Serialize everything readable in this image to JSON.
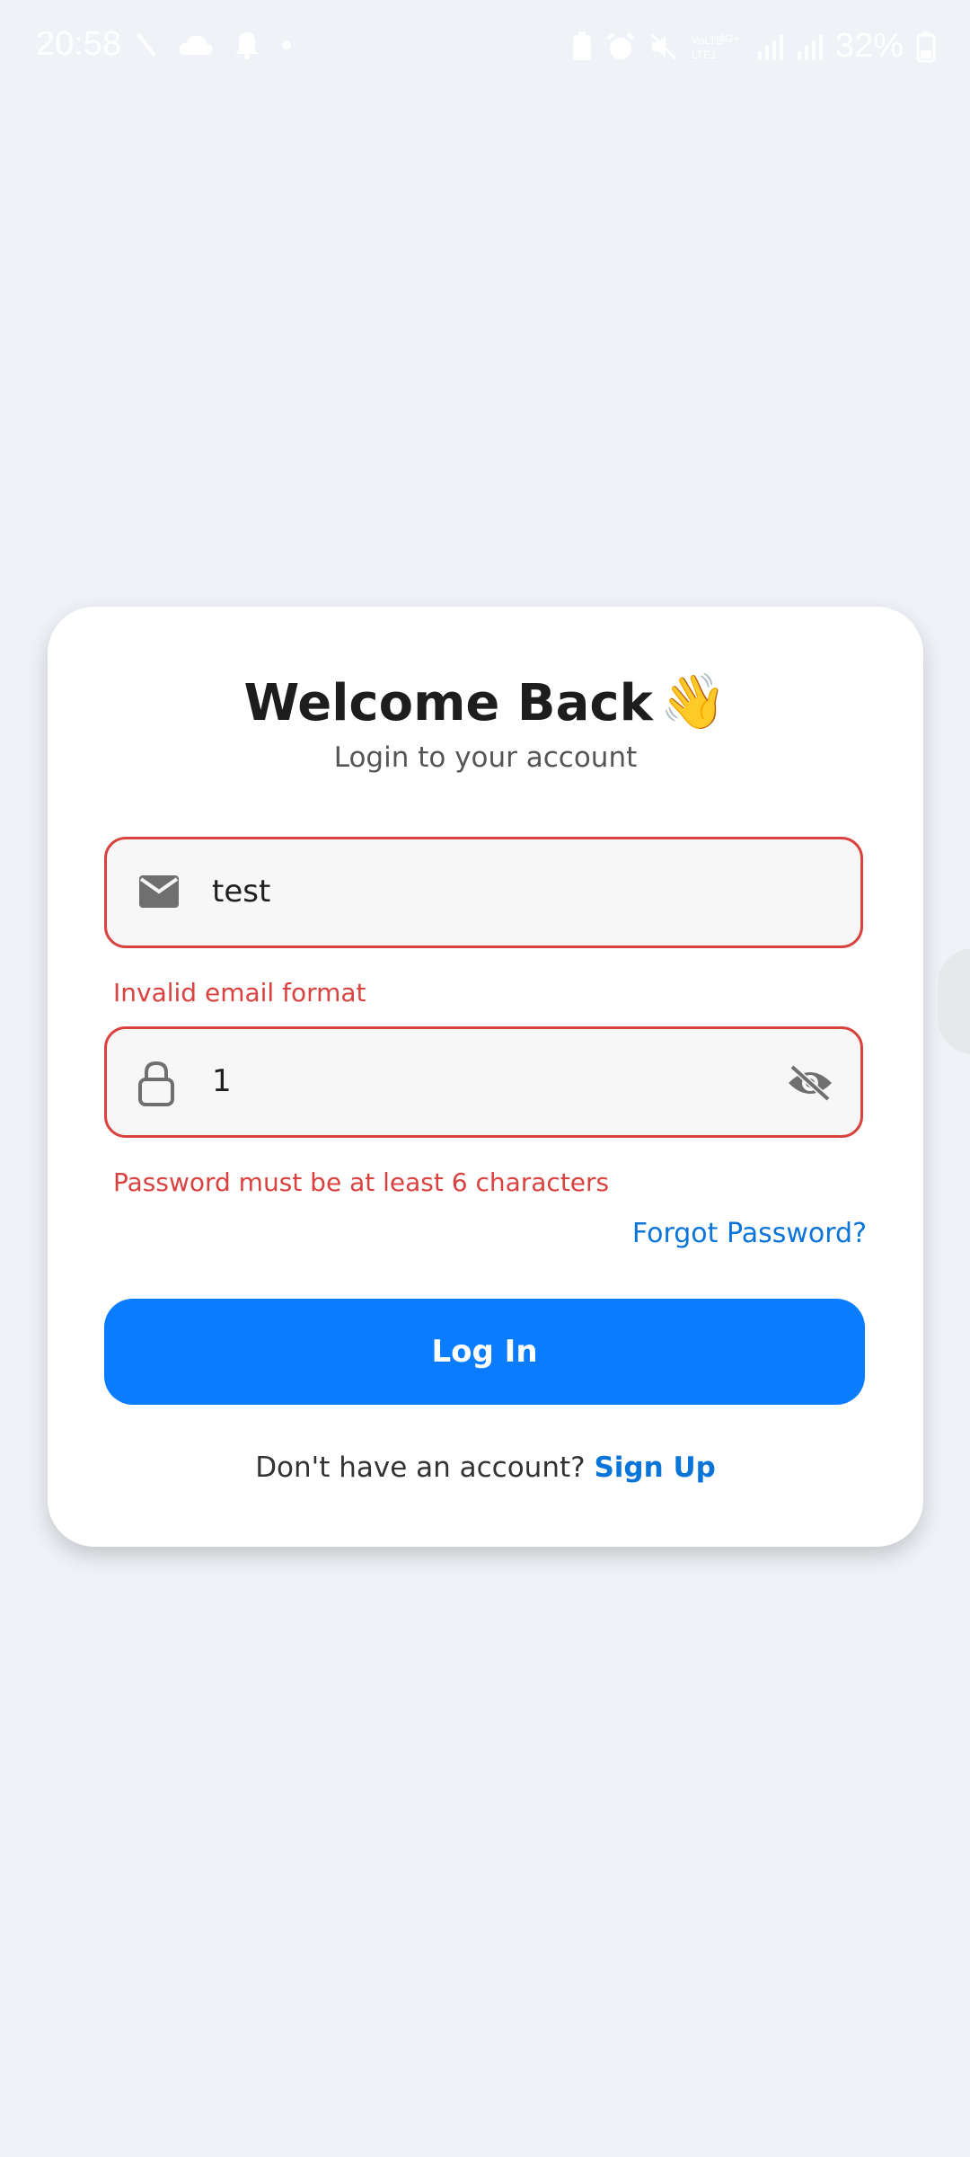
{
  "status_bar": {
    "time": "20:58",
    "battery": "32%",
    "left_icons": [
      "missed-call-icon",
      "cloud-icon",
      "notification-bell-icon",
      "dot-icon"
    ],
    "right_icons": [
      "battery-saver-icon",
      "alarm-icon",
      "mute-icon",
      "volte-icon",
      "signal-icon",
      "signal-icon",
      "battery-icon"
    ]
  },
  "login": {
    "title": "Welcome Back",
    "title_emoji": "👋",
    "subtitle": "Login to your account",
    "email": {
      "value": "test",
      "error": "Invalid email format",
      "icon": "mail-icon"
    },
    "password": {
      "value": "1",
      "error": "Password must be at least 6 characters",
      "icon": "lock-icon",
      "toggle_icon": "eye-off-icon"
    },
    "forgot_password": "Forgot Password?",
    "login_button": "Log In",
    "signup_prompt": "Don't have an account?",
    "signup_link": "Sign Up"
  },
  "colors": {
    "background": "#eff2f7",
    "card": "#ffffff",
    "error": "#d9423f",
    "primary": "#0a7cff",
    "link": "#0a74d9"
  }
}
